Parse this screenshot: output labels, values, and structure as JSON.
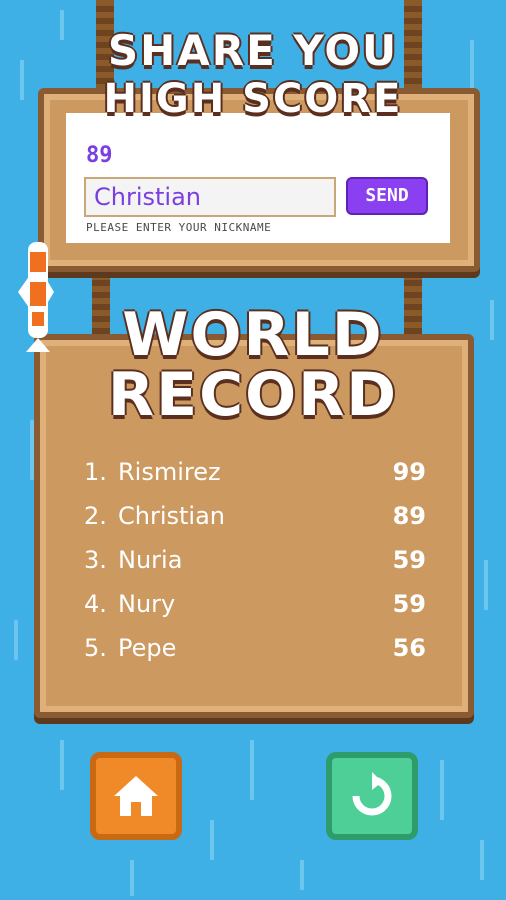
{
  "share": {
    "title_line1": "SHARE YOU",
    "title_line2": "HIGH SCORE",
    "score": "89",
    "nickname_value": "Christian",
    "send_label": "SEND",
    "hint": "PLEASE ENTER YOUR NICKNAME"
  },
  "record": {
    "title_line1": "WORLD",
    "title_line2": "RECORD",
    "entries": [
      {
        "rank": "1.",
        "name": "Rismirez",
        "score": "99"
      },
      {
        "rank": "2.",
        "name": "Christian",
        "score": "89"
      },
      {
        "rank": "3.",
        "name": "Nuria",
        "score": "59"
      },
      {
        "rank": "4.",
        "name": "Nury",
        "score": "59"
      },
      {
        "rank": "5.",
        "name": "Pepe",
        "score": "56"
      }
    ]
  },
  "buttons": {
    "home_icon": "home-icon",
    "replay_icon": "replay-icon"
  },
  "colors": {
    "background": "#3fb0e6",
    "board": "#cc9960",
    "accent_purple": "#8a3ff0",
    "home_orange": "#f08a28",
    "replay_green": "#4fcf98"
  }
}
